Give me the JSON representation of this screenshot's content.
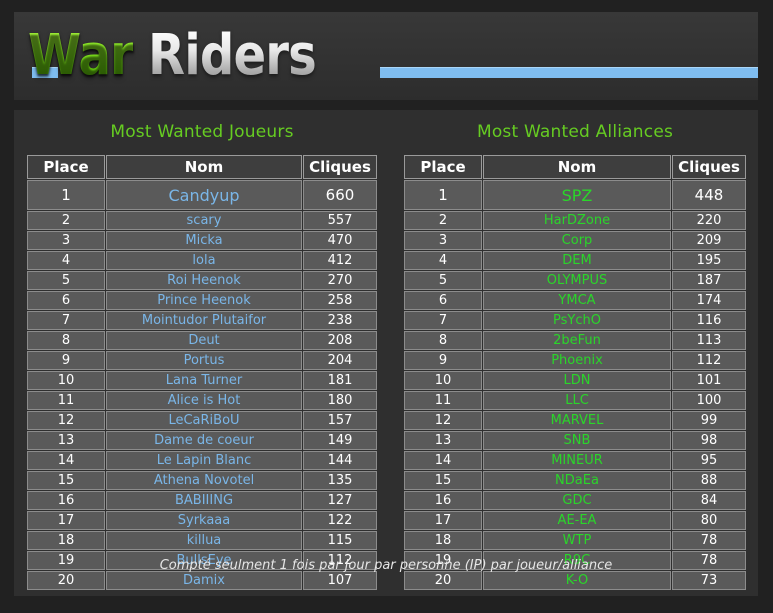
{
  "header": {
    "logo_part1": "War",
    "logo_part2": "Riders",
    "rule_color": "#7fbdf0",
    "green": "#7fe41d",
    "silver": "#e8e8e8"
  },
  "boards": {
    "players": {
      "title": "Most Wanted Joueurs",
      "name_color": "#7ab6e8",
      "columns": [
        "Place",
        "Nom",
        "Cliques"
      ],
      "rows": [
        [
          "1",
          "Candyup",
          "660"
        ],
        [
          "2",
          "scary",
          "557"
        ],
        [
          "3",
          "Micka",
          "470"
        ],
        [
          "4",
          "lola",
          "412"
        ],
        [
          "5",
          "Roi Heenok",
          "270"
        ],
        [
          "6",
          "Prince Heenok",
          "258"
        ],
        [
          "7",
          "Mointudor Plutaifor",
          "238"
        ],
        [
          "8",
          "Deut",
          "208"
        ],
        [
          "9",
          "Portus",
          "204"
        ],
        [
          "10",
          "Lana Turner",
          "181"
        ],
        [
          "11",
          "Alice is Hot",
          "180"
        ],
        [
          "12",
          "LeCaRiBoU",
          "157"
        ],
        [
          "13",
          "Dame de coeur",
          "149"
        ],
        [
          "14",
          "Le Lapin Blanc",
          "144"
        ],
        [
          "15",
          "Athena Novotel",
          "135"
        ],
        [
          "16",
          "BABIIING",
          "127"
        ],
        [
          "17",
          "Syrkaaa",
          "122"
        ],
        [
          "18",
          "killua",
          "115"
        ],
        [
          "19",
          "BullsEye",
          "112"
        ],
        [
          "20",
          "Damix",
          "107"
        ]
      ]
    },
    "alliances": {
      "title": "Most Wanted Alliances",
      "name_color": "#2ad62a",
      "columns": [
        "Place",
        "Nom",
        "Cliques"
      ],
      "rows": [
        [
          "1",
          "SPZ",
          "448"
        ],
        [
          "2",
          "HarDZone",
          "220"
        ],
        [
          "3",
          "Corp",
          "209"
        ],
        [
          "4",
          "DEM",
          "195"
        ],
        [
          "5",
          "OLYMPUS",
          "187"
        ],
        [
          "6",
          "YMCA",
          "174"
        ],
        [
          "7",
          "PsYchO",
          "116"
        ],
        [
          "8",
          "2beFun",
          "113"
        ],
        [
          "9",
          "Phoenix",
          "112"
        ],
        [
          "10",
          "LDN",
          "101"
        ],
        [
          "11",
          "LLC",
          "100"
        ],
        [
          "12",
          "MARVEL",
          "99"
        ],
        [
          "13",
          "SNB",
          "98"
        ],
        [
          "14",
          "MINEUR",
          "95"
        ],
        [
          "15",
          "NDaEa",
          "88"
        ],
        [
          "16",
          "GDC",
          "84"
        ],
        [
          "17",
          "AE-EA",
          "80"
        ],
        [
          "18",
          "WTP",
          "78"
        ],
        [
          "19",
          "R9C",
          "78"
        ],
        [
          "20",
          "K-O",
          "73"
        ]
      ]
    }
  },
  "footnote": "Compté seulment 1 fois par jour par personne (IP) par joueur/alliance"
}
